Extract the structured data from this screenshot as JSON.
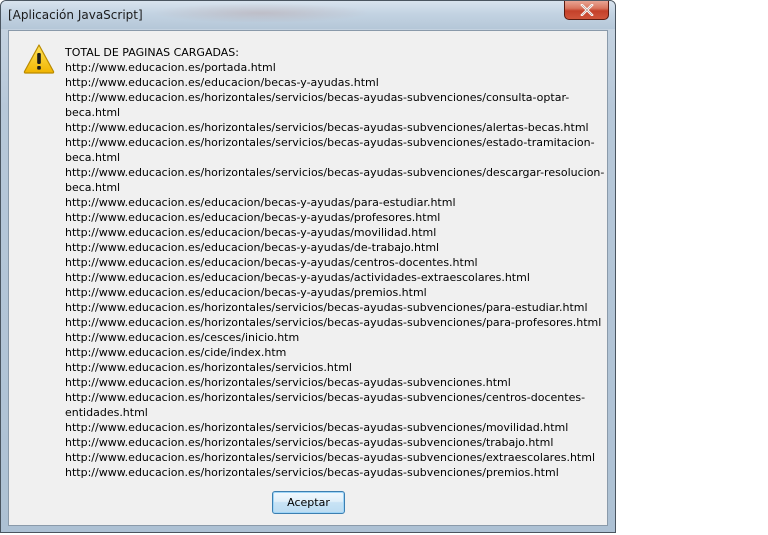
{
  "window": {
    "title": "[Aplicación JavaScript]"
  },
  "dialog": {
    "icon": "warning-icon",
    "heading": "TOTAL DE PAGINAS CARGADAS:",
    "lines": [
      "http://www.educacion.es/portada.html",
      "http://www.educacion.es/educacion/becas-y-ayudas.html",
      "http://www.educacion.es/horizontales/servicios/becas-ayudas-subvenciones/consulta-optar-",
      "beca.html",
      "http://www.educacion.es/horizontales/servicios/becas-ayudas-subvenciones/alertas-becas.html",
      "http://www.educacion.es/horizontales/servicios/becas-ayudas-subvenciones/estado-tramitacion-",
      "beca.html",
      "http://www.educacion.es/horizontales/servicios/becas-ayudas-subvenciones/descargar-resolucion-",
      "beca.html",
      "http://www.educacion.es/educacion/becas-y-ayudas/para-estudiar.html",
      "http://www.educacion.es/educacion/becas-y-ayudas/profesores.html",
      "http://www.educacion.es/educacion/becas-y-ayudas/movilidad.html",
      "http://www.educacion.es/educacion/becas-y-ayudas/de-trabajo.html",
      "http://www.educacion.es/educacion/becas-y-ayudas/centros-docentes.html",
      "http://www.educacion.es/educacion/becas-y-ayudas/actividades-extraescolares.html",
      "http://www.educacion.es/educacion/becas-y-ayudas/premios.html",
      "http://www.educacion.es/horizontales/servicios/becas-ayudas-subvenciones/para-estudiar.html",
      "http://www.educacion.es/horizontales/servicios/becas-ayudas-subvenciones/para-profesores.html",
      "http://www.educacion.es/cesces/inicio.htm",
      "http://www.educacion.es/cide/index.htm",
      "http://www.educacion.es/horizontales/servicios.html",
      "http://www.educacion.es/horizontales/servicios/becas-ayudas-subvenciones.html",
      "http://www.educacion.es/horizontales/servicios/becas-ayudas-subvenciones/centros-docentes-",
      "entidades.html",
      "http://www.educacion.es/horizontales/servicios/becas-ayudas-subvenciones/movilidad.html",
      "http://www.educacion.es/horizontales/servicios/becas-ayudas-subvenciones/trabajo.html",
      "http://www.educacion.es/horizontales/servicios/becas-ayudas-subvenciones/extraescolares.html",
      "http://www.educacion.es/horizontales/servicios/becas-ayudas-subvenciones/premios.html"
    ],
    "ok_label": "Aceptar"
  },
  "colors": {
    "close_button": "#c4412a",
    "warning_fill": "#f5c400",
    "ok_border": "#3c7fb1"
  }
}
